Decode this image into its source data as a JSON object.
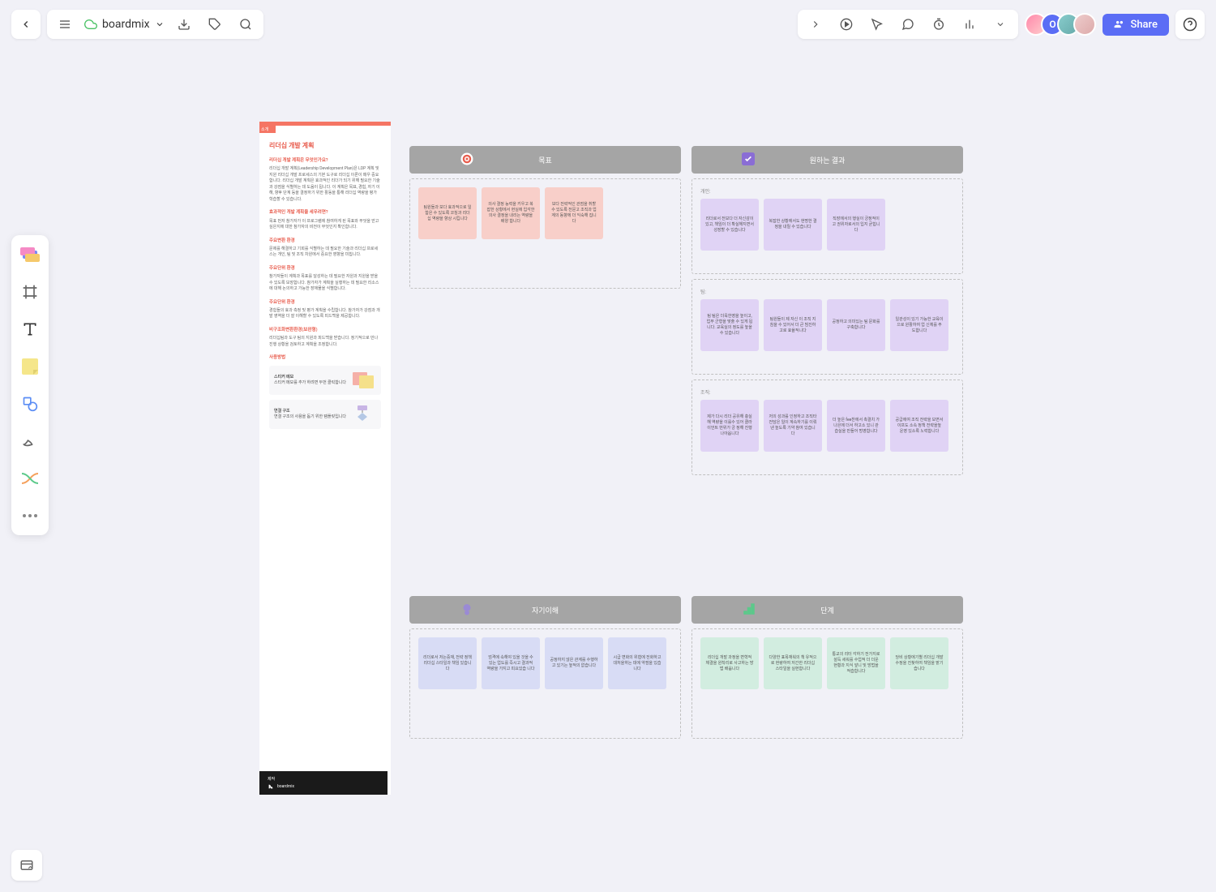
{
  "header": {
    "board_name": "boardmix",
    "share_label": "Share"
  },
  "avatar_initial": "O",
  "document": {
    "tab": "소개",
    "title": "리더십 개발 계획",
    "h1": "리더십 개발 계획은 무엇인가요?",
    "p1": "리더십 개발 계획(Leadership Development Plan)은 LDP 계획 및 지원 리더십 개발 프로세스의 기본 도구로 리더십 이론이 매우 중요합니다. 리더십 개발 계획은 효과적인 리더가 되기 위해 필요한 기술과 강점을 식별하는 데 도움이 됩니다. 이 계획은 목표, 경험, 자기 이해, 향후 단계 등을 결정하기 위한 활동을 통해 리더십 역량을 평가 학습할 수 있습니다.",
    "h2": "효과적인 개발 계획을 세우려면?",
    "p2": "목표 먼저 참가자가 이 프로그램에 참여하게 된 목표와 무엇을 얻고 싶은지에 대한 참가자의 비전이 무엇인지 확인합니다.",
    "h3": "주요변환 환경",
    "p3": "문제를 해결하고 기회를 식별하는 데 필요한 기술과 리더십 프로세스는 개인, 팀 및 조직 차원에서 중요한 영향을 미칩니다.",
    "h4": "주요단위 환경",
    "p4": "참가자들이 계획과 목표를 달성하는 데 필요한 자원과 지원을 받을 수 있도록 보장합니다. 참가자가 계획을 실행하는 데 필요한 리소스에 대해 논의하고 가능한 장애물을 식별합니다.",
    "h5": "주요단위 환경",
    "p5": "경험들의 효과 측정 및 평가 계획을 수립합니다. 참가자가 강점과 개발 영역을 더 잘 이해할 수 있도록 피드백을 제공합니다.",
    "h6": "비구조화변환환경(보완형)",
    "p6": "리더십팀과 도구 팀의 지원과 피드백을 받습니다. 정기적으로 만나 진행 상황을 검토하고 계획을 조정합니다.",
    "h7": "사용방법",
    "card1_title": "스티커 메모",
    "card1_text": "스티커 메모를 추가 하려면 두번 클릭합니다",
    "card2_title": "연결 구조",
    "card2_text": "연결 구조의 사용을 돕기 위한 템플릿입니다",
    "footer_label": "제작",
    "footer_brand": "boardmix"
  },
  "sections": {
    "goals": {
      "title": "목표",
      "notes": [
        "팀원들과 보다 효과적으로 일함은 수 있도록 코칭과 리더십 역량을 향상 시킵니다",
        "의사 결정 능력을 키우고 복잡한 상황에서 현실에 입각한 의사 결정을 내리는 역량을 배양 합니다",
        "보다 전략적인 관점을 취할 수 있도록 전문고 조직과 업계의 동향에 더 익숙해 집니다"
      ]
    },
    "results": {
      "title": "원하는 결과",
      "sub1_label": "개인:",
      "sub1_notes": [
        "리더로서 전보다 더 자신감이 있고, 책임이 더 확실해지면서 성장할 수 있습니다",
        "복잡한 상황에서도 현명한 결정을 내릴 수 있습니다",
        "직장에서의 행실이 긍정적이고 권위자로서의 입지 굳힙니다"
      ],
      "sub2_label": "팀:",
      "sub2_notes": [
        "팀 팀은 더욱한영을 높이고, 업무 군형을 맞출 수 있게 됩니다. 교육실의 정도를 높을 수 있습니다",
        "팀원들이 제 자신 이 조직 지침을 수 있어서 더 큰 빔진하고로 효율적니다",
        "공정하고 의미있는 팀 문화를 구축합니다",
        "일관성이 있기 가능한 교육이으로 원활하여 업 신체를 주도합니다"
      ],
      "sub3_label": "조직:",
      "sub3_notes": [
        "제가 다시 리더 공유해 충실해 역량을 이룰수 있어 클라이언트 번위가 긍 정해 진행나아옵니다",
        "저의 성과를 인정하고 조직타 전담은 일이 계속하기를 이뤄낸 높도록 기약 참여 있습니다",
        "더 높은 fee찬에서 촉결치 가 나은에 더서 하고소 있니 관습실을 만들어 멍영합니다",
        "공급에여 조직 전략을 보면서 이프도 소속 정책 전략을높 운영 있소록 노력합니다"
      ]
    },
    "self": {
      "title": "자기이해",
      "notes": [
        "리더로서 저는중재, 전략 정책 리더십 스타일과 책임 있습니다",
        "엄격에 속해야 있을 것을 수 있는 업도를 즉시고 결과적 역량을 가지고 피요있습 니다",
        "공정하지 않은 관계를 수행하고 있기는 높적의 없습니다",
        "시급 변화의 위협에 전화하고 대처을하는 데에 약점을 있습니다"
      ]
    },
    "steps": {
      "title": "단계",
      "notes": [
        "리더십 개발 과정을 변혁적 체결을 원착리로 사고하는 방법 배웁니다",
        "다양한 표목재워의 책 유적으로 현량하여 저간한 리더십 스타일을 실현합니다",
        "통교의 리터 각하기 전가지로 설득 세워를 수업적 더 더운 현황과 지식 앞니 및 방법을 적습합니다",
        "당비 상황에기별 리더십 개발 수정을 진찾하여 책임을 맡기습니다"
      ]
    }
  }
}
